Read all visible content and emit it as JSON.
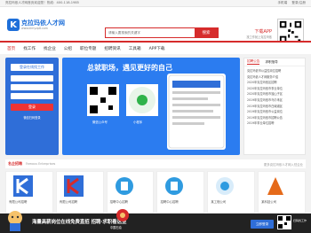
{
  "topbar": {
    "left": "亮拉玛依人才网首页欢迎您！热线：400-118-1985",
    "mobile": "手机端",
    "account": "登录/注册"
  },
  "logo": {
    "mark": "K",
    "name": "克拉玛依人才网",
    "url": "www.klmyzp8.com"
  },
  "search": {
    "placeholder": "请输入要搜索的关键字",
    "button": "搜索"
  },
  "app": {
    "title": "下载APP",
    "subtitle": "找工作就上克拉玛依"
  },
  "nav": {
    "items": [
      "首页",
      "找工作",
      "找企业",
      "公招",
      "职位专题",
      "招聘资讯",
      "工具箱",
      "APP下载"
    ],
    "active": 0
  },
  "login": {
    "header": "登录在线找工作",
    "button": "登录",
    "footer": "微信扫码登录"
  },
  "promo": {
    "title": "总就职场，遇见更好的自己",
    "qr1_label": "微信公众号",
    "qr2_label": "小程序"
  },
  "news": {
    "tab_active": "招聘公告",
    "tab2": "求职指导",
    "items": [
      "克拉玛依市公益性岗位招聘",
      "克拉玛依人才网服务介绍",
      "2020年克拉玛依区招聘",
      "2020年克拉玛依市事业单位",
      "2020年克拉玛依市独山子区",
      "2019年克拉玛依市乌尔禾区",
      "2019年克拉玛依市白碱滩区",
      "2019年克拉玛依市公益岗位",
      "2019年克拉玛依市招聘公告",
      "2019年事业单位招聘"
    ]
  },
  "section": {
    "title": "名企招聘",
    "subtitle": "Famous Enterprises",
    "more": "更多克拉玛依人才网入驻企业"
  },
  "companies": [
    {
      "name": "有限公司招聘",
      "color": "#2f6ed8"
    },
    {
      "name": "有限公司招聘",
      "color": "#d62b2b"
    },
    {
      "name": "招聘中心招聘",
      "color": "#2f9be0"
    },
    {
      "name": "招聘中心招聘",
      "color": "#2f9be0"
    },
    {
      "name": "某工程公司",
      "color": "#2f9be0"
    },
    {
      "name": "某科技公司",
      "color": "#e56a1a"
    }
  ],
  "bottom": {
    "text": "海量高薪岗位在线免费直招 招聘·求职看这里",
    "button": "立即登录",
    "caption": "扫码找工作",
    "service": "中国石油"
  }
}
